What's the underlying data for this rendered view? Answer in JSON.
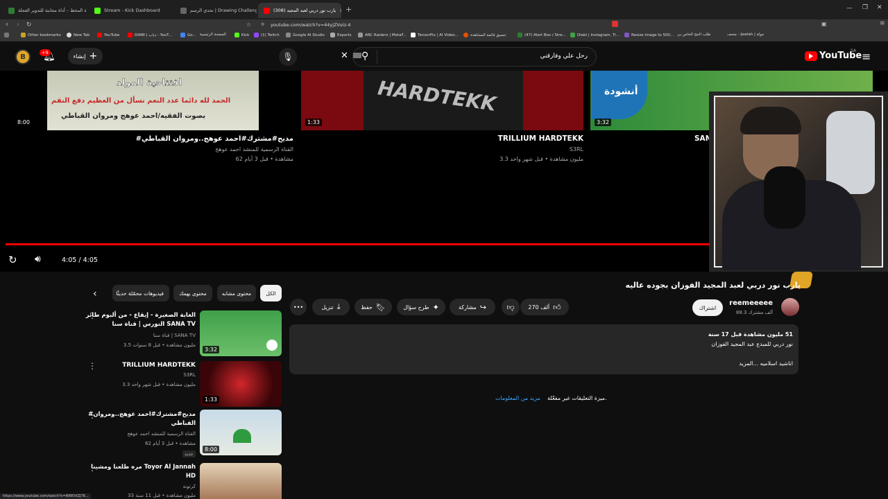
{
  "browser": {
    "tabs": [
      {
        "label": "مجلة المحط – أداة مجانية للتدوير العجلة",
        "color": "#2e7d32"
      },
      {
        "label": "Stream - Kick Dashboard",
        "color": "#53fc18"
      },
      {
        "label": "تحدي الرسم | Drawing Challenge - جز",
        "color": "#444444"
      },
      {
        "label": "(308) يارب نور دربي لعبد المجيد",
        "color": "#ff0000"
      }
    ],
    "url": "youtube.com/watch?v=44yjZVuIz-4",
    "bookmarks": [
      "Other bookmarks",
      "New Tab",
      "YouTube",
      "DIABI | دياب - YouT...",
      "Go...",
      "الصفحة الرئيسية",
      "Kick",
      "(1) Twitch",
      "Google AI Studio",
      "Esports",
      "ARC Raiders | MetaF...",
      "TensorPix | AI Video...",
      "تنسيق قائمة المشاهدة",
      "(47) Alert Box / Stre...",
      "Diabi | Instagram, Ti...",
      "Resize image to 500...",
      "طلب الحج الخاص بي",
      "متحف - Jawlah | جولة"
    ]
  },
  "youtube": {
    "logo": "YouTube",
    "region": "SA",
    "search_value": "رحل علي وفارقني",
    "create_label": "إنشاء",
    "notif_count": "+9"
  },
  "endscreen": [
    {
      "title": "#مديح#مشترك#احمد عوهج..ومروان القباطي",
      "channel": "القناة الرسمية للمنشد احمد عوهج",
      "stats": "62 مشاهدة • قبل 3 أيام",
      "duration": "8:00",
      "overlay": "افتتاحية المولد",
      "thumb_text": "الحمد لله دائما عدد النعم نسأل من العظيم دفع النقم",
      "thumb_text2": "بصوت الفقيه/احمد عوهج ومروان القباطي"
    },
    {
      "title": "TRILLIUM HARDTEKK",
      "channel": "S3RL",
      "stats": "3.3 مليون مشاهدة • قبل شهر واحد",
      "duration": "1:33",
      "overlay": "HARDTEKK"
    },
    {
      "title": "SAN",
      "duration": "3:32",
      "overlay": "أنشودة"
    }
  ],
  "player": {
    "time": "4:05 / 4:05",
    "progress": 1.0
  },
  "video": {
    "title": "يارب نور دربي لعبد المجيد الفوزان بجوده عاليه",
    "channel": "reemeeeee",
    "subscribers": "88.3 ألف مشترك",
    "subscribe_label": "اشتراك",
    "likes": "270 ألف",
    "share_label": "مشاركة",
    "ask_label": "طرح سؤال",
    "save_label": "حفظ",
    "download_label": "تنزيل",
    "views_line": "51 مليون مشاهدة  قبل 17 سنة",
    "desc_line": "نور دربي للمبدع عبد المجيد الفوزان",
    "desc_more": "اناشيد اسلاميه ...المزيد",
    "comments_off": "ميزة التعليقات غير مفعّلة.",
    "learn_more": "مزيد من المعلومات"
  },
  "chips": [
    "الكل",
    "محتوى مشابه",
    "محتوى يهمك",
    "فيديوهات محمّلة حديثًا"
  ],
  "related": [
    {
      "title_line1": "الغابة الصغيرة - إيقاع - من ألبوم طائر",
      "title_line2": "النورس | قناة سنا SANA TV",
      "channel": "قناة سنا | SANA TV",
      "stats": "3.5 مليون مشاهدة • قبل 8 سنوات",
      "duration": "3:32"
    },
    {
      "title_line1": "TRILLIUM HARDTEKK",
      "title_line2": "",
      "channel": "S3RL",
      "stats": "3.3 مليون مشاهدة • قبل شهر واحد",
      "duration": "1:33"
    },
    {
      "title_line1": "#مديح#مشترك#احمد عوهج..ومروان",
      "title_line2": "القباطي",
      "channel": "القناة الرسمية للمنشد احمد عوهج",
      "stats": "62 مشاهدة • قبل 3 أيام",
      "duration": "8:00",
      "badge": "جديد"
    },
    {
      "title_line1": "مره طلعنا ومشينا Toyor Al Jannah",
      "title_line2": "HD",
      "channel": "كرتونة",
      "stats": "33 مليون مشاهدة • قبل 11 سنة",
      "duration": ""
    }
  ],
  "status_url": "https://www.youtube.com/watch?v=W6KVtZj78..."
}
